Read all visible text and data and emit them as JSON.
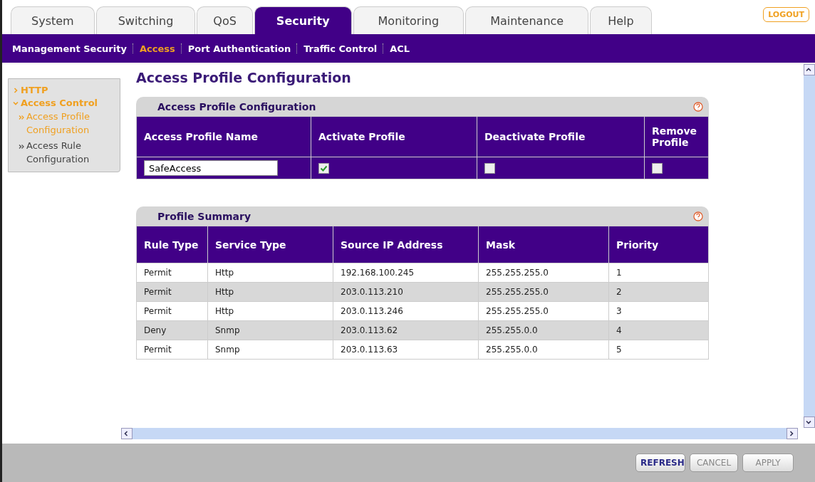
{
  "tabs": [
    {
      "label": "System",
      "selected": false
    },
    {
      "label": "Switching",
      "selected": false
    },
    {
      "label": "QoS",
      "selected": false
    },
    {
      "label": "Security",
      "selected": true
    },
    {
      "label": "Monitoring",
      "selected": false
    },
    {
      "label": "Maintenance",
      "selected": false
    },
    {
      "label": "Help",
      "selected": false
    }
  ],
  "logout": "LOGOUT",
  "subnav": [
    {
      "label": "Management Security",
      "selected": false
    },
    {
      "label": "Access",
      "selected": true
    },
    {
      "label": "Port Authentication",
      "selected": false
    },
    {
      "label": "Traffic Control",
      "selected": false
    },
    {
      "label": "ACL",
      "selected": false
    }
  ],
  "sidebar": {
    "items": [
      {
        "label": "HTTP",
        "expanded": false
      },
      {
        "label": "Access Control",
        "expanded": true,
        "children": [
          {
            "label": "Access Profile Configuration",
            "selected": true
          },
          {
            "label": "Access Rule Configuration",
            "selected": false
          }
        ]
      }
    ]
  },
  "page_title": "Access Profile Configuration",
  "config_panel": {
    "title": "Access Profile Configuration",
    "columns": [
      "Access Profile Name",
      "Activate Profile",
      "Deactivate Profile",
      "Remove Profile"
    ],
    "name_value": "SafeAccess",
    "activate": true,
    "deactivate": false,
    "remove": false
  },
  "summary_panel": {
    "title": "Profile Summary",
    "columns": [
      "Rule Type",
      "Service Type",
      "Source IP Address",
      "Mask",
      "Priority"
    ],
    "rows": [
      [
        "Permit",
        "Http",
        "192.168.100.245",
        "255.255.255.0",
        "1"
      ],
      [
        "Permit",
        "Http",
        "203.0.113.210",
        "255.255.255.0",
        "2"
      ],
      [
        "Permit",
        "Http",
        "203.0.113.246",
        "255.255.255.0",
        "3"
      ],
      [
        "Deny",
        "Snmp",
        "203.0.113.62",
        "255.255.0.0",
        "4"
      ],
      [
        "Permit",
        "Snmp",
        "203.0.113.63",
        "255.255.0.0",
        "5"
      ]
    ]
  },
  "buttons": [
    {
      "label": "REFRESH",
      "disabled": false
    },
    {
      "label": "CANCEL",
      "disabled": true
    },
    {
      "label": "APPLY",
      "disabled": true
    }
  ]
}
